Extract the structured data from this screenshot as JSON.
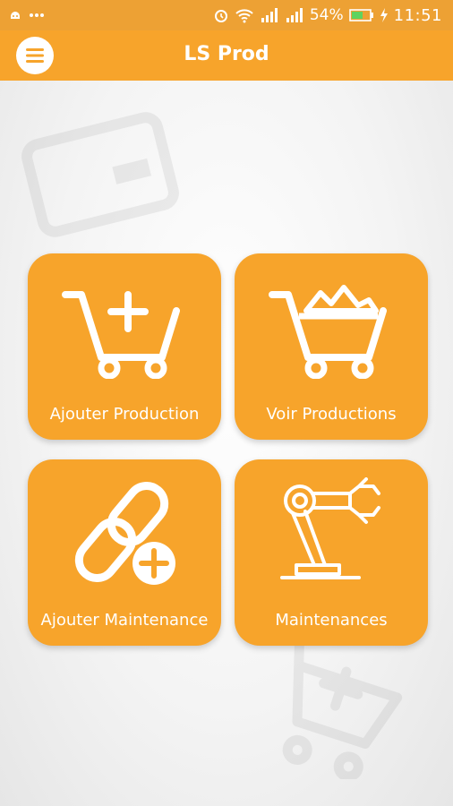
{
  "status_bar": {
    "battery": "54%",
    "time": "11:51",
    "icons": [
      "android-icon",
      "more-icon",
      "alarm-icon",
      "wifi-icon",
      "signal-icon",
      "signal-icon-2",
      "battery-icon",
      "charging-icon"
    ]
  },
  "app_bar": {
    "title": "LS Prod",
    "menu_icon": "menu-icon"
  },
  "tiles": [
    {
      "label": "Ajouter Production",
      "icon": "cart-add-icon"
    },
    {
      "label": "Voir Productions",
      "icon": "cart-full-icon"
    },
    {
      "label": "Ajouter Maintenance",
      "icon": "link-add-icon"
    },
    {
      "label": "Maintenances",
      "icon": "robot-arm-icon"
    }
  ],
  "colors": {
    "primary": "#f7a42b",
    "status_bar": "#eda134",
    "text_on_primary": "#ffffff"
  }
}
